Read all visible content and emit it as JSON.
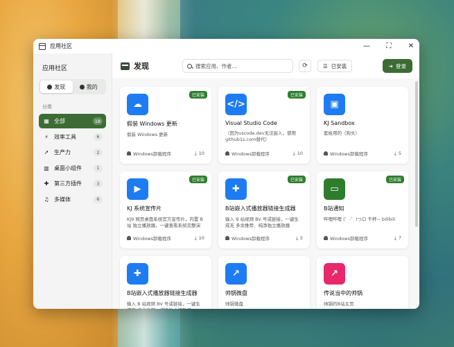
{
  "window": {
    "title": "应用社区"
  },
  "window_controls": {
    "minimize": "—",
    "maximize": "⛶",
    "close": "✕"
  },
  "sidebar": {
    "title": "应用社区",
    "tabs": [
      {
        "label": "发现",
        "icon": "compass-icon",
        "active": true
      },
      {
        "label": "我的",
        "icon": "user-icon",
        "active": false
      }
    ],
    "section_label": "分类",
    "categories": [
      {
        "label": "全部",
        "count": "18",
        "icon": "grid-icon",
        "glyph": "▦",
        "active": true
      },
      {
        "label": "效率工具",
        "count": "6",
        "icon": "bolt-icon",
        "glyph": "⚡"
      },
      {
        "label": "生产力",
        "count": "2",
        "icon": "rocket-icon",
        "glyph": "➚"
      },
      {
        "label": "桌面小组件",
        "count": "1",
        "icon": "widget-icon",
        "glyph": "▥"
      },
      {
        "label": "第三方插件",
        "count": "3",
        "icon": "puzzle-icon",
        "glyph": "✚"
      },
      {
        "label": "多媒体",
        "count": "6",
        "icon": "music-icon",
        "glyph": "♫"
      }
    ]
  },
  "header": {
    "title": "发现",
    "search_placeholder": "搜索应用、作者...",
    "refresh_glyph": "⟳",
    "installed_filter": "已安装",
    "installed_glyph": "☰",
    "login": "登录",
    "login_glyph": "➜"
  },
  "colors": {
    "accent": "#3c6c34",
    "badge": "#2f7d2f",
    "blue": "#1e7cf2",
    "green": "#2e7d2e",
    "pink": "#e8286b"
  },
  "apps": [
    {
      "name": "假装 Windows 更新",
      "desc": "假装 Windows 更新",
      "author": "Windows卸载程序",
      "downloads": "10",
      "installed": true,
      "icon": "cloud-upload-icon",
      "glyph": "☁",
      "color": "#1e7cf2"
    },
    {
      "name": "Visual Studio Code",
      "desc": "（因为vscode.dev无法嵌入，使用github1s.com替代）",
      "author": "Windows卸载程序",
      "downloads": "10",
      "installed": true,
      "icon": "code-icon",
      "glyph": "</>",
      "color": "#1e7cf2"
    },
    {
      "name": "KJ Sandbox",
      "desc": "套娃用的（狗头）",
      "author": "Windows卸载程序",
      "downloads": "5",
      "installed": false,
      "icon": "box-icon",
      "glyph": "▣",
      "color": "#1e7cf2"
    },
    {
      "name": "KJ 系统宣传片",
      "desc": "KJ9 网页桌面系统官方宣传片，内置 B 站 独立播放器，一键查看系统完整演示效...",
      "author": "Windows卸载程序",
      "downloads": "10",
      "installed": true,
      "icon": "video-icon",
      "glyph": "▶",
      "color": "#1e7cf2"
    },
    {
      "name": "B站嵌入式播放器链接生成器",
      "desc": "输入 B 站视频 BV 号或链接，一键生成无 多余推荐、纯净独立播放器 iframe 地...",
      "author": "Windows卸载程序",
      "downloads": "5",
      "installed": true,
      "icon": "puzzle-icon",
      "glyph": "✚",
      "color": "#1e7cf2"
    },
    {
      "name": "B站通知",
      "desc": "哔哩哔哩 (゜-゜)つロ 干杯~ bilibili",
      "author": "Windows卸载程序",
      "downloads": "7",
      "installed": true,
      "icon": "tv-icon",
      "glyph": "▭",
      "color": "#2e7d2e"
    },
    {
      "name": "B站嵌入式播放器链接生成器",
      "desc": "输入 B 站视频 BV 号或链接，一键生成无 多余推荐、纯净独立播放器 iframe 地...",
      "author": "",
      "downloads": "",
      "installed": false,
      "icon": "puzzle-icon",
      "glyph": "✚",
      "color": "#1e7cf2"
    },
    {
      "name": "帅锅微盘",
      "desc": "帅锅微盘",
      "author": "",
      "downloads": "",
      "installed": false,
      "icon": "external-link-icon",
      "glyph": "↗",
      "color": "#1e7cf2"
    },
    {
      "name": "传说当中的帅锅",
      "desc": "帅锅的B站主页",
      "author": "",
      "downloads": "",
      "installed": false,
      "icon": "external-link-icon",
      "glyph": "↗",
      "color": "#e8286b"
    }
  ],
  "installed_badge": "已安装"
}
